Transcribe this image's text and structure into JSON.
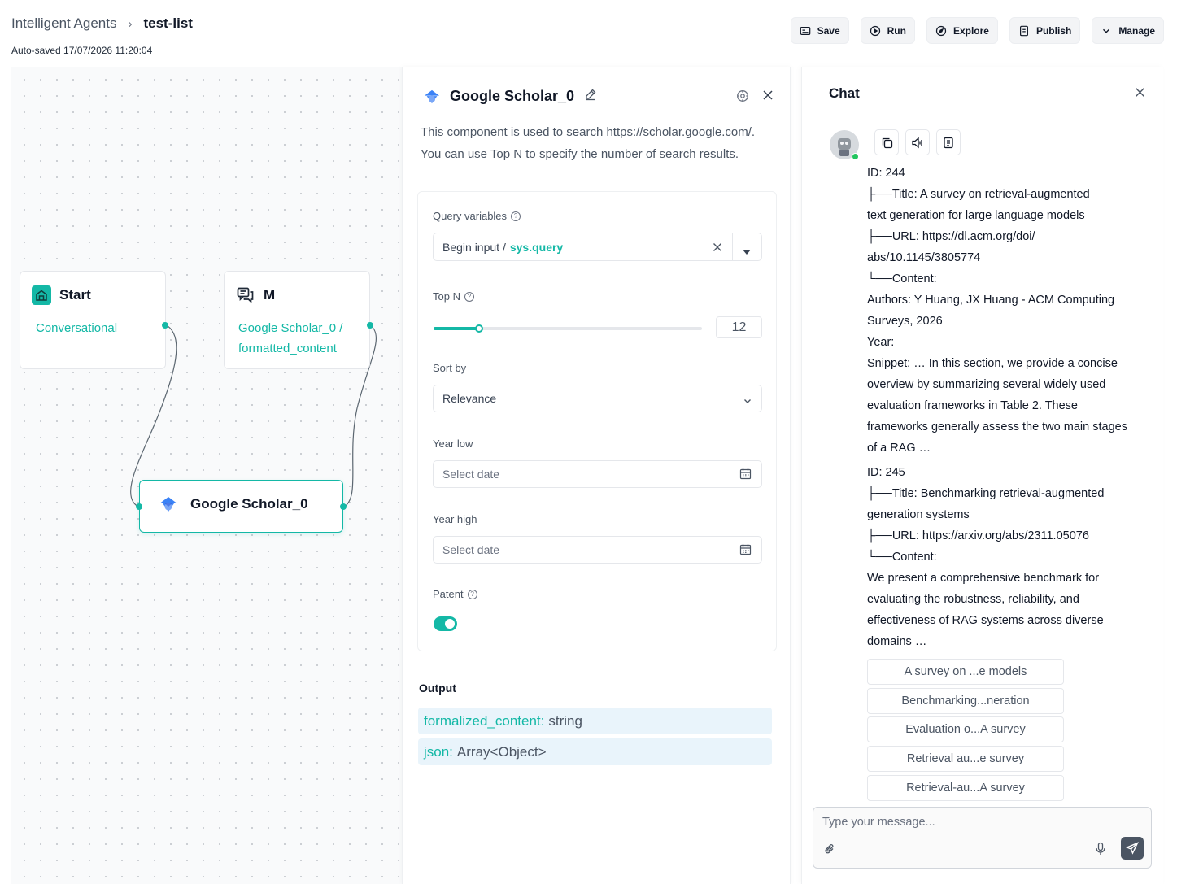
{
  "header": {
    "breadcrumb_parent": "Intelligent Agents",
    "breadcrumb_sep": "›",
    "breadcrumb_current": "test-list",
    "autosave": "Auto-saved 17/07/2026 11:20:04",
    "buttons": {
      "save": "Save",
      "run": "Run",
      "explore": "Explore",
      "publish": "Publish",
      "manage": "Manage"
    }
  },
  "canvas": {
    "start_node": {
      "title": "Start",
      "subtitle": "Conversational",
      "icon": "home-icon"
    },
    "message_node": {
      "title": "M",
      "line1": "Google Scholar_0 /",
      "line2": "formatted_content",
      "icon": "chat-bubbles-icon"
    },
    "scholar_node": {
      "title": "Google Scholar_0",
      "icon": "graduation-cap-icon"
    },
    "accent": "#14b8a6"
  },
  "config": {
    "title": "Google Scholar_0",
    "description": "This component is used to search https://scholar.google.com/. You can use Top N to specify the number of search results.",
    "query_label": "Query variables",
    "query_source": "Begin input /",
    "query_var": "sys.query",
    "topn_label": "Top N",
    "topn_value": "12",
    "topn_fraction": 0.17,
    "sort_label": "Sort by",
    "sort_value": "Relevance",
    "year_low_label": "Year low",
    "year_low_placeholder": "Select date",
    "year_high_label": "Year high",
    "year_high_placeholder": "Select date",
    "patent_label": "Patent",
    "patent_on": true,
    "output_title": "Output",
    "outputs": [
      {
        "key": "formalized_content:",
        "type": "string"
      },
      {
        "key": "json:",
        "type": "Array<Object>"
      }
    ]
  },
  "chat": {
    "title": "Chat",
    "message_lines": [
      "ID: 244",
      "├──Title: A survey on retrieval-augmented",
      "text generation for large language models",
      "├──URL: https://dl.acm.org/doi/",
      "abs/10.1145/3805774",
      "└──Content:",
      "Authors: Y Huang, JX Huang - ACM Computing",
      "Surveys, 2026",
      "Year:",
      "Snippet: … In this section, we provide a concise",
      "overview by summarizing several widely used",
      "evaluation frameworks in Table 2. These",
      "frameworks generally assess the two main stages",
      "of a RAG …",
      "ID: 245",
      "├──Title: Benchmarking retrieval-augmented",
      "generation systems",
      "├──URL: https://arxiv.org/abs/2311.05076",
      "└──Content:",
      "We present a comprehensive benchmark for",
      "evaluating the robustness, reliability, and",
      "effectiveness of RAG systems across diverse",
      "domains …"
    ],
    "references": [
      "A survey on ...e models",
      "Benchmarking...neration",
      "Evaluation o...A survey",
      "Retrieval au...e survey",
      "Retrieval-au...A survey"
    ],
    "input_placeholder": "Type your message..."
  }
}
